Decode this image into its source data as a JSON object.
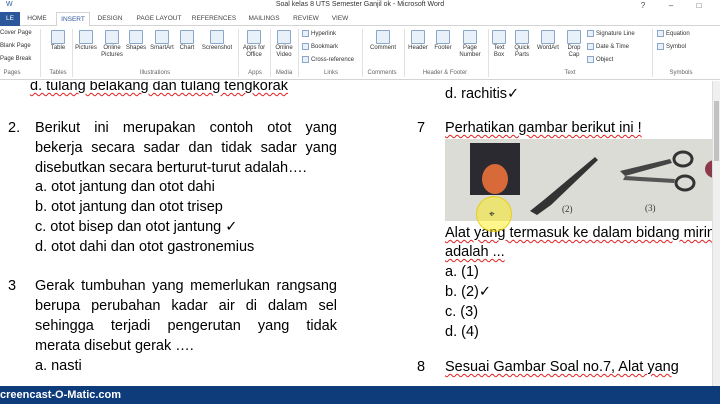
{
  "window": {
    "title": "Soal kelas 8 UTS Semester Ganjil ok -  Microsoft Word",
    "quick_access": "W",
    "controls": [
      "?",
      "–",
      "□"
    ]
  },
  "tabs": {
    "file": "LE",
    "items": [
      "HOME",
      "INSERT",
      "DESIGN",
      "PAGE LAYOUT",
      "REFERENCES",
      "MAILINGS",
      "REVIEW",
      "VIEW"
    ],
    "active": "INSERT"
  },
  "ribbon": {
    "pages": {
      "items": [
        "Cover Page",
        "Blank Page",
        "Page Break"
      ],
      "label": "Pages"
    },
    "tables": {
      "button": "Table",
      "label": "Tables"
    },
    "illustrations": {
      "buttons": [
        "Pictures",
        "Online Pictures",
        "Shapes",
        "SmartArt",
        "Chart",
        "Screenshot"
      ],
      "label": "Illustrations"
    },
    "apps": {
      "button": "Apps for Office",
      "label": "Apps"
    },
    "media": {
      "button": "Online Video",
      "label": "Media"
    },
    "links": {
      "items": [
        "Hyperlink",
        "Bookmark",
        "Cross-reference"
      ],
      "label": "Links"
    },
    "comments": {
      "button": "Comment",
      "label": "Comments"
    },
    "header_footer": {
      "buttons": [
        "Header",
        "Footer",
        "Page Number"
      ],
      "label": "Header & Footer"
    },
    "text": {
      "buttons": [
        "Text Box",
        "Quick Parts",
        "WordArt",
        "Drop Cap"
      ],
      "items": [
        "Signature Line",
        "Date & Time",
        "Object"
      ],
      "label": "Text"
    },
    "symbols": {
      "items": [
        "Equation",
        "Symbol"
      ],
      "label": "Symbols"
    }
  },
  "document": {
    "left": {
      "top_partial": "d.   tulang belakang dan tulang tengkorak",
      "q2": {
        "number": "2.",
        "lines": [
          "Berikut ini merupakan contoh otot yang",
          "bekerja secara sadar dan tidak sadar yang",
          "disebutkan secara berturut-turut adalah…."
        ],
        "options": [
          "a. otot jantung dan otot dahi",
          "b. otot jantung dan otot trisep",
          "c. otot bisep dan otot jantung ✓",
          "d. otot dahi dan otot gastronemius"
        ]
      },
      "q3": {
        "number": "3",
        "lines": [
          "Gerak tumbuhan yang memerlukan rangsang",
          "berupa perubahan kadar air di dalam sel",
          "sehingga terjadi pengerutan yang tidak",
          "merata disebut gerak …."
        ],
        "options": [
          "a. nasti"
        ]
      }
    },
    "right": {
      "top_partial": "d. rachitis✓",
      "q7": {
        "number": "7",
        "line": "Perhatikan gambar berikut ini !",
        "figure_labels": [
          "(2)",
          "(3)"
        ],
        "after": [
          "Alat yang termasuk ke dalam bidang mirin",
          "adalah ..."
        ],
        "options": [
          "a. (1)",
          "b. (2)✓",
          "c. (3)",
          "d. (4)"
        ]
      },
      "q8": {
        "number": "8",
        "line": "Sesuai Gambar Soal no.7, Alat yang"
      }
    }
  },
  "taskbar": {
    "watermark": "creencast-O-Matic.com"
  },
  "colors": {
    "word_blue": "#2b579a",
    "taskbar": "#0e3b7a",
    "squiggle": "#e02020",
    "highlight": "#ffeb00"
  }
}
